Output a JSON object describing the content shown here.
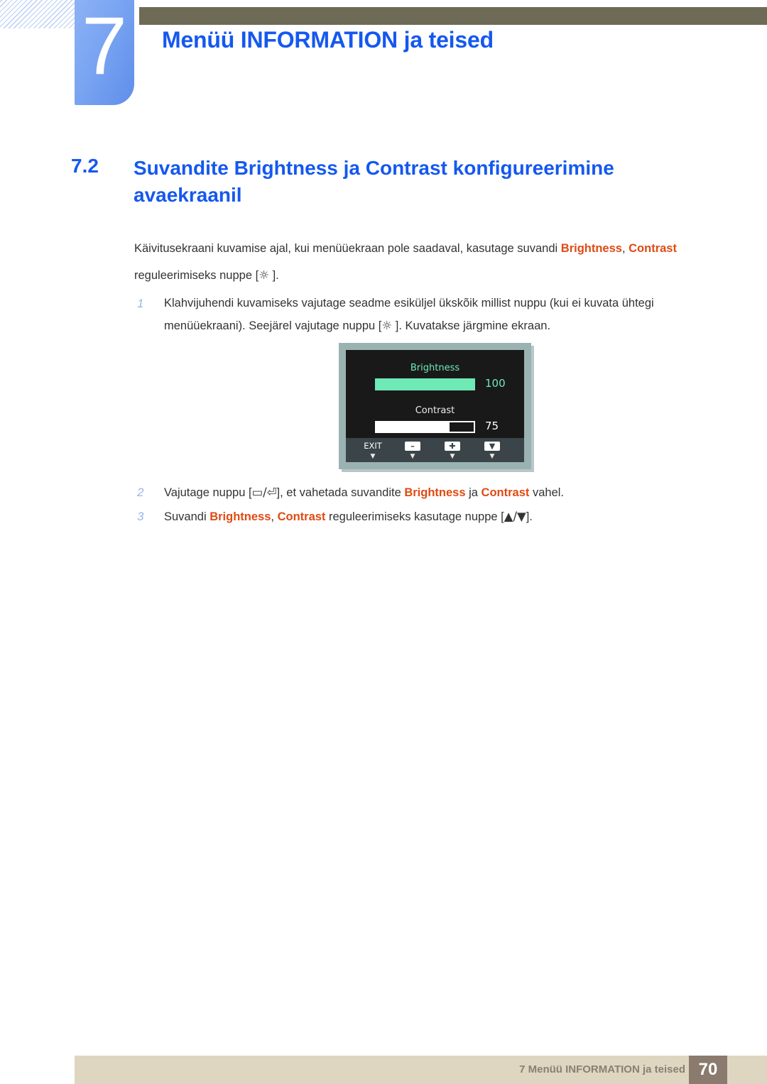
{
  "header": {
    "chapter_number": "7",
    "chapter_title": "Menüü INFORMATION ja teised",
    "accent_blue": "#1558f0",
    "olive_bar_color": "#6d6a56",
    "chapter_block_color": "#79a4f2"
  },
  "section": {
    "number": "7.2",
    "title": "Suvandite Brightness ja Contrast konfigureerimine avaekraanil"
  },
  "body": {
    "paragraph_part1": "Käivitusekraani kuvamise ajal, kui menüüekraan pole saadaval, kasutage suvandi ",
    "term_brightness": "Brightness",
    "paragraph_comma": ", ",
    "term_contrast": "Contrast",
    "paragraph_part2": " reguleerimiseks nuppe [",
    "sun_glyph": "☼",
    "paragraph_part3": " ].",
    "highlight_color": "#e04a13"
  },
  "steps": [
    {
      "number": "1",
      "text_part1": "Klahvijuhendi kuvamiseks vajutage seadme esiküljel ükskõik millist nuppu (kui ei kuvata ühtegi menüüekraani). Seejärel vajutage nuppu [",
      "glyph": "☼",
      "text_part2": " ]. Kuvatakse järgmine ekraan."
    },
    {
      "number": "2",
      "text_part1": "Vajutage nuppu [",
      "glyph_a": "▭",
      "glyph_sep": "/",
      "glyph_b": "⏎",
      "text_part2": "], et vahetada suvandite ",
      "term_a": "Brightness",
      "text_part3": " ja ",
      "term_b": "Contrast",
      "text_part4": " vahel."
    },
    {
      "number": "3",
      "text_part1": "Suvandi ",
      "term_a": "Brightness",
      "text_part2": ", ",
      "term_b": "Contrast",
      "text_part3": " reguleerimiseks kasutage nuppe [",
      "glyph_a": "▲",
      "glyph_sep": "/",
      "glyph_b": "▼",
      "text_part4": "]."
    }
  ],
  "osd": {
    "frame_color": "#9bb2b2",
    "screen_color": "#191919",
    "bottom_bar_color": "#3b4448",
    "brightness": {
      "label": "Brightness",
      "value": "100",
      "fill_percent": 100,
      "color": "#6fe9b6"
    },
    "contrast": {
      "label": "Contrast",
      "value": "75",
      "fill_percent": 75,
      "color": "#ffffff"
    },
    "buttons": [
      {
        "label": "EXIT",
        "type": "text",
        "marker": "▼"
      },
      {
        "label": "–",
        "type": "icon",
        "marker": "▼"
      },
      {
        "label": "✚",
        "type": "icon",
        "marker": "▼"
      },
      {
        "label": "▼",
        "type": "icon",
        "marker": "▼"
      }
    ]
  },
  "footer": {
    "text": "7 Menüü INFORMATION ja teised",
    "page_number": "70",
    "band_color": "#ded6c0",
    "page_box_color": "#8a7b6e"
  }
}
